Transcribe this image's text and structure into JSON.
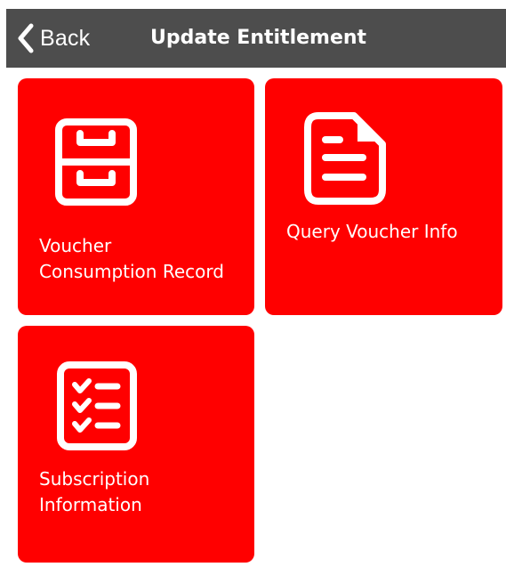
{
  "header": {
    "back_label": "Back",
    "title": "Update Entitlement",
    "back_icon": "chevron-left-icon"
  },
  "tiles": [
    {
      "label_lines": [
        "Voucher",
        "Consumption Record"
      ],
      "icon": "file-cabinet-icon"
    },
    {
      "label_lines": [
        "Query Voucher Info"
      ],
      "icon": "document-icon"
    },
    {
      "label_lines": [
        "Subscription",
        "Information"
      ],
      "icon": "checklist-icon"
    }
  ],
  "colors": {
    "header_bg": "#4d4d4d",
    "tile_bg": "#ff0000",
    "foreground": "#ffffff"
  }
}
